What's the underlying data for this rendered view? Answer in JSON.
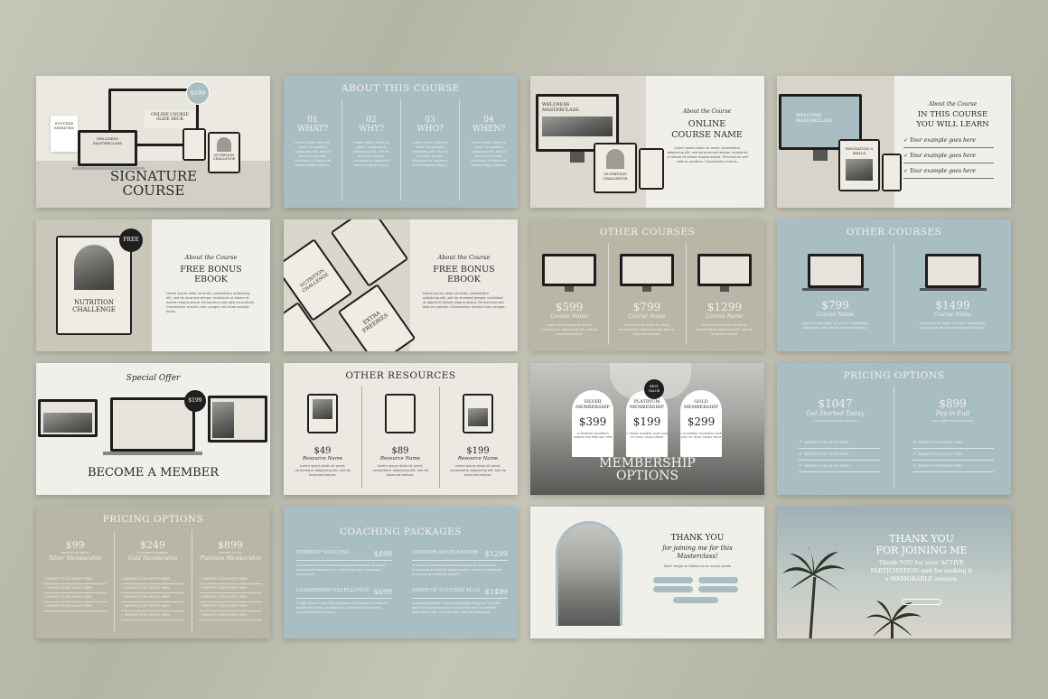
{
  "s1": {
    "line1": "SIGNATURE",
    "line2": "COURSE",
    "badge": "$199",
    "tag1": "ONLINE COURSE",
    "tag2": "SLIDE DECK",
    "tag3": "WELLNESS",
    "tag4": "MASTERCLASS",
    "tag5": "NUTRITION",
    "tag6": "CHALLENGE",
    "tag7": "SUCCESS",
    "tag8": "SESSIONS"
  },
  "s2": {
    "title": "ABOUT THIS COURSE",
    "cols": [
      {
        "n": "01",
        "q": "WHAT?"
      },
      {
        "n": "02",
        "q": "WHY?"
      },
      {
        "n": "03",
        "q": "WHO?"
      },
      {
        "n": "04",
        "q": "WHEN?"
      }
    ]
  },
  "s3": {
    "sub": "About the Course",
    "t1": "ONLINE",
    "t2": "COURSE NAME",
    "mon1": "WELLNESS",
    "mon2": "MASTERCLASS",
    "tab1": "NUTRITION",
    "tab2": "CHALLENGE"
  },
  "s4": {
    "sub": "About the Course",
    "t1": "IN THIS COURSE",
    "t2": "YOU WILL LEARN",
    "items": [
      "Your example goes here",
      "Your example goes here",
      "Your example goes here"
    ],
    "w1": "WELCOME",
    "w2": "MASTERCLASS",
    "t3": "INNOVATION &",
    "t4": "SKILLS"
  },
  "s5": {
    "sub": "About the Course",
    "t1": "FREE BONUS",
    "t2": "EBOOK",
    "badge": "FREE",
    "b1": "NUTRITION",
    "b2": "CHALLENGE"
  },
  "s6": {
    "sub": "About the Course",
    "t1": "FREE BONUS",
    "t2": "EBOOK",
    "b1": "NUTRITION",
    "b2": "CHALLENGE",
    "b3": "EXTRA",
    "b4": "FREEBIES"
  },
  "s7": {
    "title": "OTHER COURSES",
    "items": [
      {
        "p": "$599",
        "n": "Course Name"
      },
      {
        "p": "$799",
        "n": "Course Name"
      },
      {
        "p": "$1299",
        "n": "Course Name"
      }
    ]
  },
  "s8": {
    "title": "OTHER COURSES",
    "items": [
      {
        "p": "$799",
        "n": "Course Name"
      },
      {
        "p": "$1499",
        "n": "Course Name"
      }
    ]
  },
  "s9": {
    "sub": "Special Offer",
    "title": "BECOME A MEMBER",
    "badge": "$199"
  },
  "s10": {
    "title": "OTHER RESOURCES",
    "items": [
      {
        "p": "$49",
        "n": "Resource Name"
      },
      {
        "p": "$89",
        "n": "Resource Name"
      },
      {
        "p": "$199",
        "n": "Resource Name"
      }
    ]
  },
  "s11": {
    "t1": "MEMBERSHIP",
    "t2": "OPTIONS",
    "badge": "BEST VALUE",
    "arches": [
      {
        "n1": "SILVER",
        "n2": "MEMBERSHIP",
        "p": "$399"
      },
      {
        "n1": "PLATINUM",
        "n2": "MEMBERSHIP",
        "p": "$199"
      },
      {
        "n1": "GOLD",
        "n2": "MEMBERSHIP",
        "p": "$299"
      }
    ]
  },
  "s12": {
    "title": "PRICING OPTIONS",
    "cols": [
      {
        "p": "$1047",
        "n": "Get Started Today"
      },
      {
        "p": "$899",
        "n": "Pay in Full"
      }
    ],
    "benefit": "BENEFIT GOES RIGHT HERE"
  },
  "s13": {
    "title": "PRICING OPTIONS",
    "cols": [
      {
        "p": "$99",
        "n": "Silver Membership"
      },
      {
        "p": "$249",
        "n": "Gold Membership"
      },
      {
        "p": "$899",
        "n": "Platinum Membership"
      }
    ],
    "benefit": "BENEFIT GOES RIGHT HERE"
  },
  "s14": {
    "title": "COACHING PACKAGES",
    "items": [
      {
        "n": "START-UP SUCCESS",
        "p": "$499"
      },
      {
        "n": "GROWTH ACCELERATOR",
        "p": "$1299"
      },
      {
        "n": "LEADERSHIP EXCELLENCE",
        "p": "$699"
      },
      {
        "n": "START-UP SUCCESS PLUS",
        "p": "$2499"
      }
    ]
  },
  "s15": {
    "t1": "THANK YOU",
    "t2": "for joining me for this",
    "t3": "Masterclass!",
    "t4": "Don't forget to follow me on social media"
  },
  "s16": {
    "t1": "THANK YOU",
    "t2": "FOR JOINING ME",
    "t3": "Thank YOU for your ACTIVE",
    "t4": "PARTICIPATION and for making it",
    "t5": "a MEMORABLE session."
  }
}
